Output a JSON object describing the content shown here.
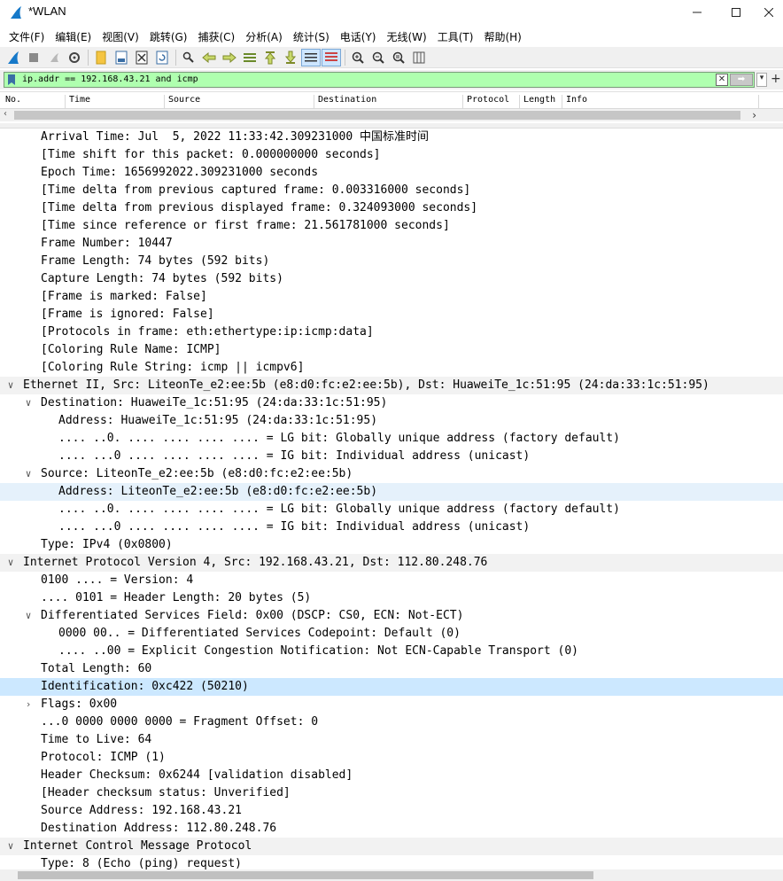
{
  "window": {
    "title": "*WLAN",
    "controls": {
      "minimize": "—",
      "maximize": "☐",
      "close": "✕"
    }
  },
  "menu": [
    "文件(F)",
    "编辑(E)",
    "视图(V)",
    "跳转(G)",
    "捕获(C)",
    "分析(A)",
    "统计(S)",
    "电话(Y)",
    "无线(W)",
    "工具(T)",
    "帮助(H)"
  ],
  "toolbar": {
    "icons": [
      "shark-start-icon",
      "stop-icon",
      "restart-icon",
      "options-icon",
      "open-file-icon",
      "save-file-icon",
      "close-file-icon",
      "reload-icon",
      "find-icon",
      "back-icon",
      "forward-icon",
      "goto-icon",
      "first-icon",
      "last-icon",
      "autoscroll-icon",
      "colorize-icon",
      "zoom-in-icon",
      "zoom-out-icon",
      "zoom-normal-icon",
      "resize-columns-icon"
    ]
  },
  "filter": {
    "value": "ip.addr == 192.168.43.21 and icmp",
    "colors": {
      "valid_bg": "#afffaf"
    }
  },
  "packet_list": {
    "columns": [
      "No.",
      "Time",
      "Source",
      "Destination",
      "Protocol",
      "Length",
      "Info"
    ]
  },
  "details": {
    "rows": [
      {
        "indent": 2,
        "text": "Arrival Time: Jul  5, 2022 11:33:42.309231000 中国标准时间"
      },
      {
        "indent": 2,
        "text": "[Time shift for this packet: 0.000000000 seconds]"
      },
      {
        "indent": 2,
        "text": "Epoch Time: 1656992022.309231000 seconds"
      },
      {
        "indent": 2,
        "text": "[Time delta from previous captured frame: 0.003316000 seconds]"
      },
      {
        "indent": 2,
        "text": "[Time delta from previous displayed frame: 0.324093000 seconds]"
      },
      {
        "indent": 2,
        "text": "[Time since reference or first frame: 21.561781000 seconds]"
      },
      {
        "indent": 2,
        "text": "Frame Number: 10447"
      },
      {
        "indent": 2,
        "text": "Frame Length: 74 bytes (592 bits)"
      },
      {
        "indent": 2,
        "text": "Capture Length: 74 bytes (592 bits)"
      },
      {
        "indent": 2,
        "text": "[Frame is marked: False]"
      },
      {
        "indent": 2,
        "text": "[Frame is ignored: False]"
      },
      {
        "indent": 2,
        "text": "[Protocols in frame: eth:ethertype:ip:icmp:data]"
      },
      {
        "indent": 2,
        "text": "[Coloring Rule Name: ICMP]"
      },
      {
        "indent": 2,
        "text": "[Coloring Rule String: icmp || icmpv6]"
      },
      {
        "indent": 1,
        "text": "Ethernet II, Src: LiteonTe_e2:ee:5b (e8:d0:fc:e2:ee:5b), Dst: HuaweiTe_1c:51:95 (24:da:33:1c:51:95)",
        "expander": "v",
        "section": true
      },
      {
        "indent": 2,
        "text": "Destination: HuaweiTe_1c:51:95 (24:da:33:1c:51:95)",
        "expander": "v"
      },
      {
        "indent": 3,
        "text": "Address: HuaweiTe_1c:51:95 (24:da:33:1c:51:95)"
      },
      {
        "indent": 3,
        "text": ".... ..0. .... .... .... .... = LG bit: Globally unique address (factory default)"
      },
      {
        "indent": 3,
        "text": ".... ...0 .... .... .... .... = IG bit: Individual address (unicast)"
      },
      {
        "indent": 2,
        "text": "Source: LiteonTe_e2:ee:5b (e8:d0:fc:e2:ee:5b)",
        "expander": "v"
      },
      {
        "indent": 3,
        "text": "Address: LiteonTe_e2:ee:5b (e8:d0:fc:e2:ee:5b)",
        "hover": true
      },
      {
        "indent": 3,
        "text": ".... ..0. .... .... .... .... = LG bit: Globally unique address (factory default)"
      },
      {
        "indent": 3,
        "text": ".... ...0 .... .... .... .... = IG bit: Individual address (unicast)"
      },
      {
        "indent": 2,
        "text": "Type: IPv4 (0x0800)"
      },
      {
        "indent": 1,
        "text": "Internet Protocol Version 4, Src: 192.168.43.21, Dst: 112.80.248.76",
        "expander": "v",
        "section": true
      },
      {
        "indent": 2,
        "text": "0100 .... = Version: 4"
      },
      {
        "indent": 2,
        "text": ".... 0101 = Header Length: 20 bytes (5)"
      },
      {
        "indent": 2,
        "text": "Differentiated Services Field: 0x00 (DSCP: CS0, ECN: Not-ECT)",
        "expander": "v"
      },
      {
        "indent": 3,
        "text": "0000 00.. = Differentiated Services Codepoint: Default (0)"
      },
      {
        "indent": 3,
        "text": ".... ..00 = Explicit Congestion Notification: Not ECN-Capable Transport (0)"
      },
      {
        "indent": 2,
        "text": "Total Length: 60"
      },
      {
        "indent": 2,
        "text": "Identification: 0xc422 (50210)",
        "selected": true
      },
      {
        "indent": 2,
        "text": "Flags: 0x00",
        "expander": ">"
      },
      {
        "indent": 2,
        "text": "...0 0000 0000 0000 = Fragment Offset: 0"
      },
      {
        "indent": 2,
        "text": "Time to Live: 64"
      },
      {
        "indent": 2,
        "text": "Protocol: ICMP (1)"
      },
      {
        "indent": 2,
        "text": "Header Checksum: 0x6244 [validation disabled]"
      },
      {
        "indent": 2,
        "text": "[Header checksum status: Unverified]"
      },
      {
        "indent": 2,
        "text": "Source Address: 192.168.43.21"
      },
      {
        "indent": 2,
        "text": "Destination Address: 112.80.248.76"
      },
      {
        "indent": 1,
        "text": "Internet Control Message Protocol",
        "expander": "v",
        "section": true
      },
      {
        "indent": 2,
        "text": "Type: 8 (Echo (ping) request)"
      }
    ]
  }
}
